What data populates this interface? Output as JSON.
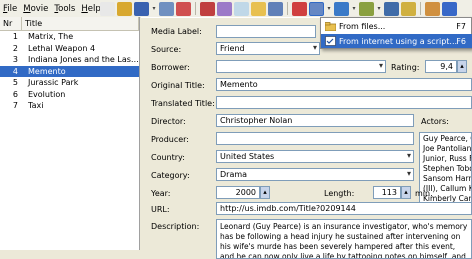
{
  "menu": [
    "File",
    "Movie",
    "Tools",
    "Help"
  ],
  "toolbar": {
    "icons": [
      "new-icon",
      "open-icon",
      "save-icon",
      "print-icon",
      "export-icon",
      "import-icon",
      "cut-icon",
      "copy-icon",
      "paste-icon",
      "find-icon",
      "picture-icon",
      "script-menu-icon",
      "web-icon",
      "settings-icon",
      "statistics-icon",
      "options-icon",
      "wrench-icon",
      "help-icon"
    ],
    "colors": [
      "#e8e8e8",
      "#d8a830",
      "#3a62b0",
      "#7090c0",
      "#d05050",
      "#c04040",
      "#9c7ac8",
      "#c0d8e8",
      "#e8c050",
      "#6080b8",
      "#d04040",
      "#6688c4",
      "#3a7ac8",
      "#8aa040",
      "#406ca8",
      "#d0b040",
      "#d09040",
      "#3868c8"
    ]
  },
  "list": {
    "col_nr": "Nr",
    "col_title": "Title",
    "rows": [
      {
        "nr": "1",
        "title": "Matrix, The"
      },
      {
        "nr": "2",
        "title": "Lethal Weapon 4"
      },
      {
        "nr": "3",
        "title": "Indiana Jones and the Last..."
      },
      {
        "nr": "4",
        "title": "Memento"
      },
      {
        "nr": "5",
        "title": "Jurassic Park"
      },
      {
        "nr": "6",
        "title": "Evolution"
      },
      {
        "nr": "7",
        "title": "Taxi"
      }
    ],
    "selected_index": 3
  },
  "form": {
    "media_label": "Media Label:",
    "source_label": "Source:",
    "source_value": "Friend",
    "borrower_label": "Borrower:",
    "rating_label": "Rating:",
    "rating_value": "9,4",
    "original_title_label": "Original Title:",
    "original_title_value": "Memento",
    "translated_title_label": "Translated Title:",
    "director_label": "Director:",
    "director_value": "Christopher Nolan",
    "producer_label": "Producer:",
    "actors_label": "Actors:",
    "actors_value": "Guy Pearce, Ca\nJoe Pantoliano\nJunior, Russ Fe\nStephen Tobolo\nSansom Harris,\n(III), Callum Ke\nKimberly Camp",
    "country_label": "Country:",
    "country_value": "United States",
    "category_label": "Category:",
    "category_value": "Drama",
    "year_label": "Year:",
    "year_value": "2000",
    "length_label": "Length:",
    "length_value": "113",
    "length_unit": "min.",
    "url_label": "URL:",
    "url_value": "http://us.imdb.com/Title?0209144",
    "description_label": "Description:",
    "description_value": "Leonard (Guy Pearce) is an insurance investigator, who's memory has be following a head injury he sustained after intervening on his wife's murde has been severely hampered after this event, and he can now only live a life by tattooing notes on himself, and taking pictures of things with a Pola"
  },
  "popup": {
    "items": [
      {
        "label": "From files...",
        "shortcut": "F7"
      },
      {
        "label": "From internet using a script...",
        "shortcut": "F6"
      }
    ],
    "highlighted_index": 1
  }
}
